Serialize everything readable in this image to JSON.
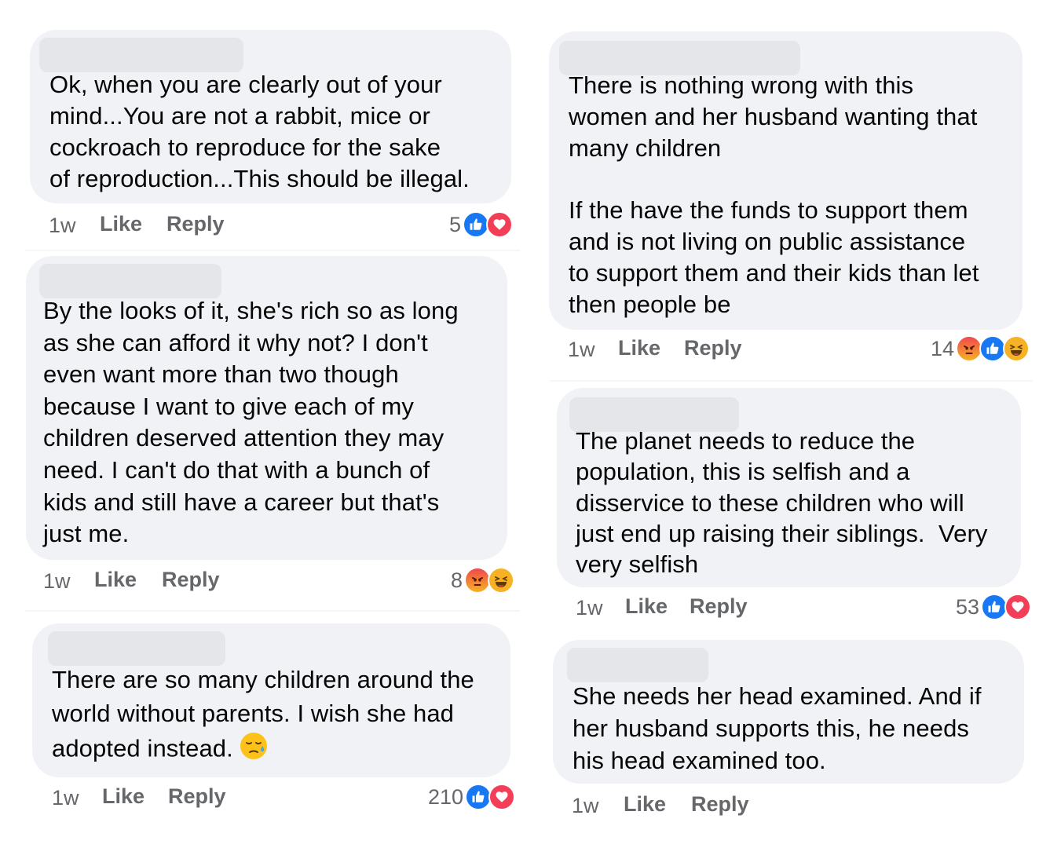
{
  "meta": {
    "like_label": "Like",
    "reply_label": "Reply"
  },
  "comments": [
    {
      "text": "Ok, when you are clearly out of your\nmind...You are not a rabbit, mice or\ncockroach to reproduce for the sake\nof reproduction...This should be illegal.",
      "time": "1w",
      "reaction_count": "5",
      "reactions": [
        "like-icon",
        "love-icon"
      ]
    },
    {
      "text": "By the looks of it, she's rich so as long\nas she can afford it why not? I don't\neven want more than two though\nbecause I want to give each of my\nchildren deserved attention they may\nneed. I can't do that with a bunch of\nkids and still have a career but that's\njust me.",
      "time": "1w",
      "reaction_count": "8",
      "reactions": [
        "angry-icon",
        "haha-icon"
      ]
    },
    {
      "text": "There are so many children around the\nworld without parents. I wish she had\nadopted instead.",
      "emoji": "sad-sweat-emoji",
      "time": "1w",
      "reaction_count": "210",
      "reactions": [
        "like-icon",
        "love-icon"
      ]
    },
    {
      "text": "There is nothing wrong with this\nwomen and her husband wanting that\nmany children\n\nIf the have the funds to support them\nand is not living on public assistance\nto support them and their kids than let\nthen people be",
      "time": "1w",
      "reaction_count": "14",
      "reactions": [
        "angry-icon",
        "like-icon",
        "haha-icon"
      ]
    },
    {
      "text": "The planet needs to reduce the\npopulation, this is selfish and a\ndisservice to these children who will\njust end up raising their siblings.  Very\nvery selfish",
      "time": "1w",
      "reaction_count": "53",
      "reactions": [
        "like-icon",
        "love-icon"
      ]
    },
    {
      "text": "She needs her head examined. And if\nher husband supports this, he needs\nhis head examined too.",
      "time": "1w"
    }
  ],
  "colors": {
    "bubble": "#f0f2f5",
    "meta_text": "#65676b",
    "like_blue": "#1877f2",
    "love_red": "#f33e58",
    "reaction_yellow": "#f7b125"
  }
}
